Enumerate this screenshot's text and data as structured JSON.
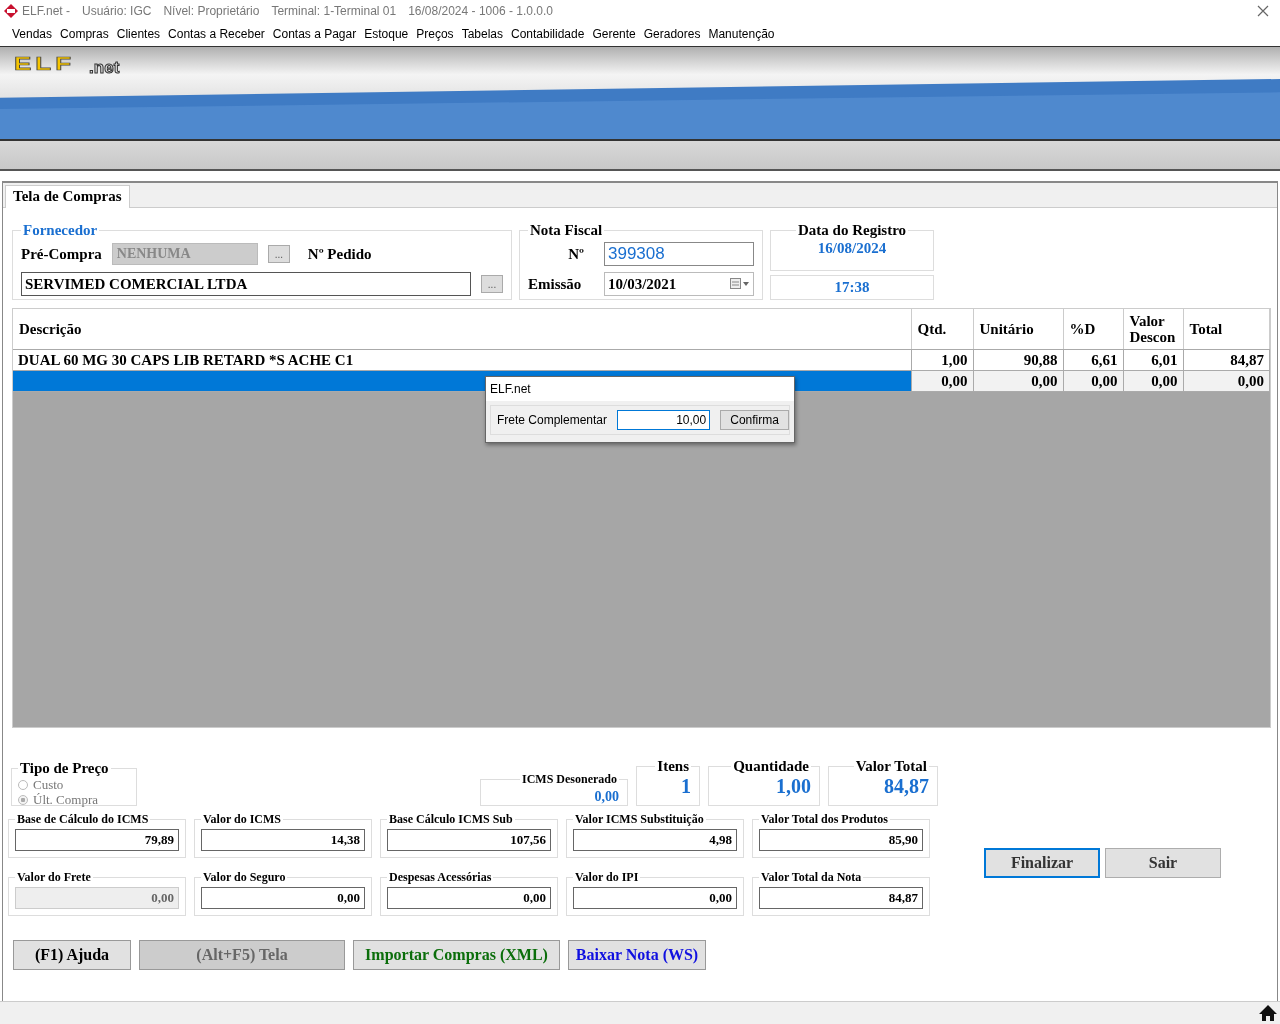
{
  "title_bar": {
    "app": "ELF.net -",
    "user": "Usuário: IGC",
    "level": "Nível: Proprietário",
    "terminal": "Terminal: 1-Terminal 01",
    "info": "16/08/2024 - 1006 - 1.0.0.0"
  },
  "menu": [
    "Vendas",
    "Compras",
    "Clientes",
    "Contas a Receber",
    "Contas a Pagar",
    "Estoque",
    "Preços",
    "Tabelas",
    "Contabilidade",
    "Gerente",
    "Geradores",
    "Manutenção"
  ],
  "banner": {
    "logo": "ELF",
    "logo_suffix": ".net"
  },
  "tabs": [
    {
      "label": "Tela de Compras",
      "selected": true
    }
  ],
  "fornecedor": {
    "legend": "Fornecedor",
    "pre_compra_label": "Pré-Compra",
    "pre_compra_value": "NENHUMA",
    "pre_compra_disabled": true,
    "pre_compra_button": "...",
    "pedido_label": "Nº Pedido",
    "supplier": "SERVIMED COMERCIAL LTDA",
    "supplier_button": "..."
  },
  "nota_fiscal": {
    "legend": "Nota Fiscal",
    "numero_label": "Nº",
    "numero": "399308",
    "emissao_label": "Emissão",
    "emissao": "10/03/2021"
  },
  "data_registro": {
    "legend": "Data do Registro",
    "date": "16/08/2024",
    "time": "17:38"
  },
  "table": {
    "columns": [
      "Descrição",
      "Qtd.",
      "Unitário",
      "%D",
      "Valor Descon",
      "Total"
    ],
    "rows": [
      {
        "selected": false,
        "cells": [
          "DUAL 60 MG 30 CAPS LIB RETARD *S ACHE C1",
          "1,00",
          "90,88",
          "6,61",
          "6,01",
          "84,87"
        ]
      },
      {
        "selected": true,
        "cells": [
          "",
          "0,00",
          "0,00",
          "0,00",
          "0,00",
          "0,00"
        ]
      }
    ]
  },
  "dialog": {
    "title": "ELF.net",
    "label": "Frete Complementar",
    "value": "10,00",
    "button": "Confirma"
  },
  "tipo_preco": {
    "legend": "Tipo de Preço",
    "disabled": true,
    "options": [
      {
        "label": "Custo",
        "selected": false
      },
      {
        "label": "Últ. Compra",
        "selected": true
      }
    ]
  },
  "icms_desonerado": {
    "label": "ICMS Desonerado",
    "value": "0,00"
  },
  "totals": [
    {
      "label": "Itens",
      "value": "1"
    },
    {
      "label": "Quantidade",
      "value": "1,00"
    },
    {
      "label": "Valor Total",
      "value": "84,87"
    }
  ],
  "fields": [
    {
      "label": "Base de Cálculo do ICMS",
      "value": "79,89",
      "disabled": false
    },
    {
      "label": "Valor do ICMS",
      "value": "14,38",
      "disabled": false
    },
    {
      "label": "Base Cálculo ICMS Sub",
      "value": "107,56",
      "disabled": false
    },
    {
      "label": "Valor ICMS Substituição",
      "value": "4,98",
      "disabled": false
    },
    {
      "label": "Valor Total dos Produtos",
      "value": "85,90",
      "disabled": false
    },
    {
      "label": "Valor do Frete",
      "value": "0,00",
      "disabled": true
    },
    {
      "label": "Valor do Seguro",
      "value": "0,00",
      "disabled": false
    },
    {
      "label": "Despesas Acessórias",
      "value": "0,00",
      "disabled": false
    },
    {
      "label": "Valor do IPI",
      "value": "0,00",
      "disabled": false
    },
    {
      "label": "Valor Total da Nota",
      "value": "84,87",
      "disabled": false
    }
  ],
  "actions": [
    {
      "label": "Finalizar",
      "focused": true
    },
    {
      "label": "Sair",
      "focused": false
    }
  ],
  "bottom_buttons": [
    {
      "label": "(F1) Ajuda",
      "kind": "default"
    },
    {
      "label": "(Alt+F5) Tela",
      "kind": "disabled"
    },
    {
      "label": "Importar Compras (XML)",
      "kind": "import"
    },
    {
      "label": "Baixar Nota (WS)",
      "kind": "download"
    }
  ]
}
